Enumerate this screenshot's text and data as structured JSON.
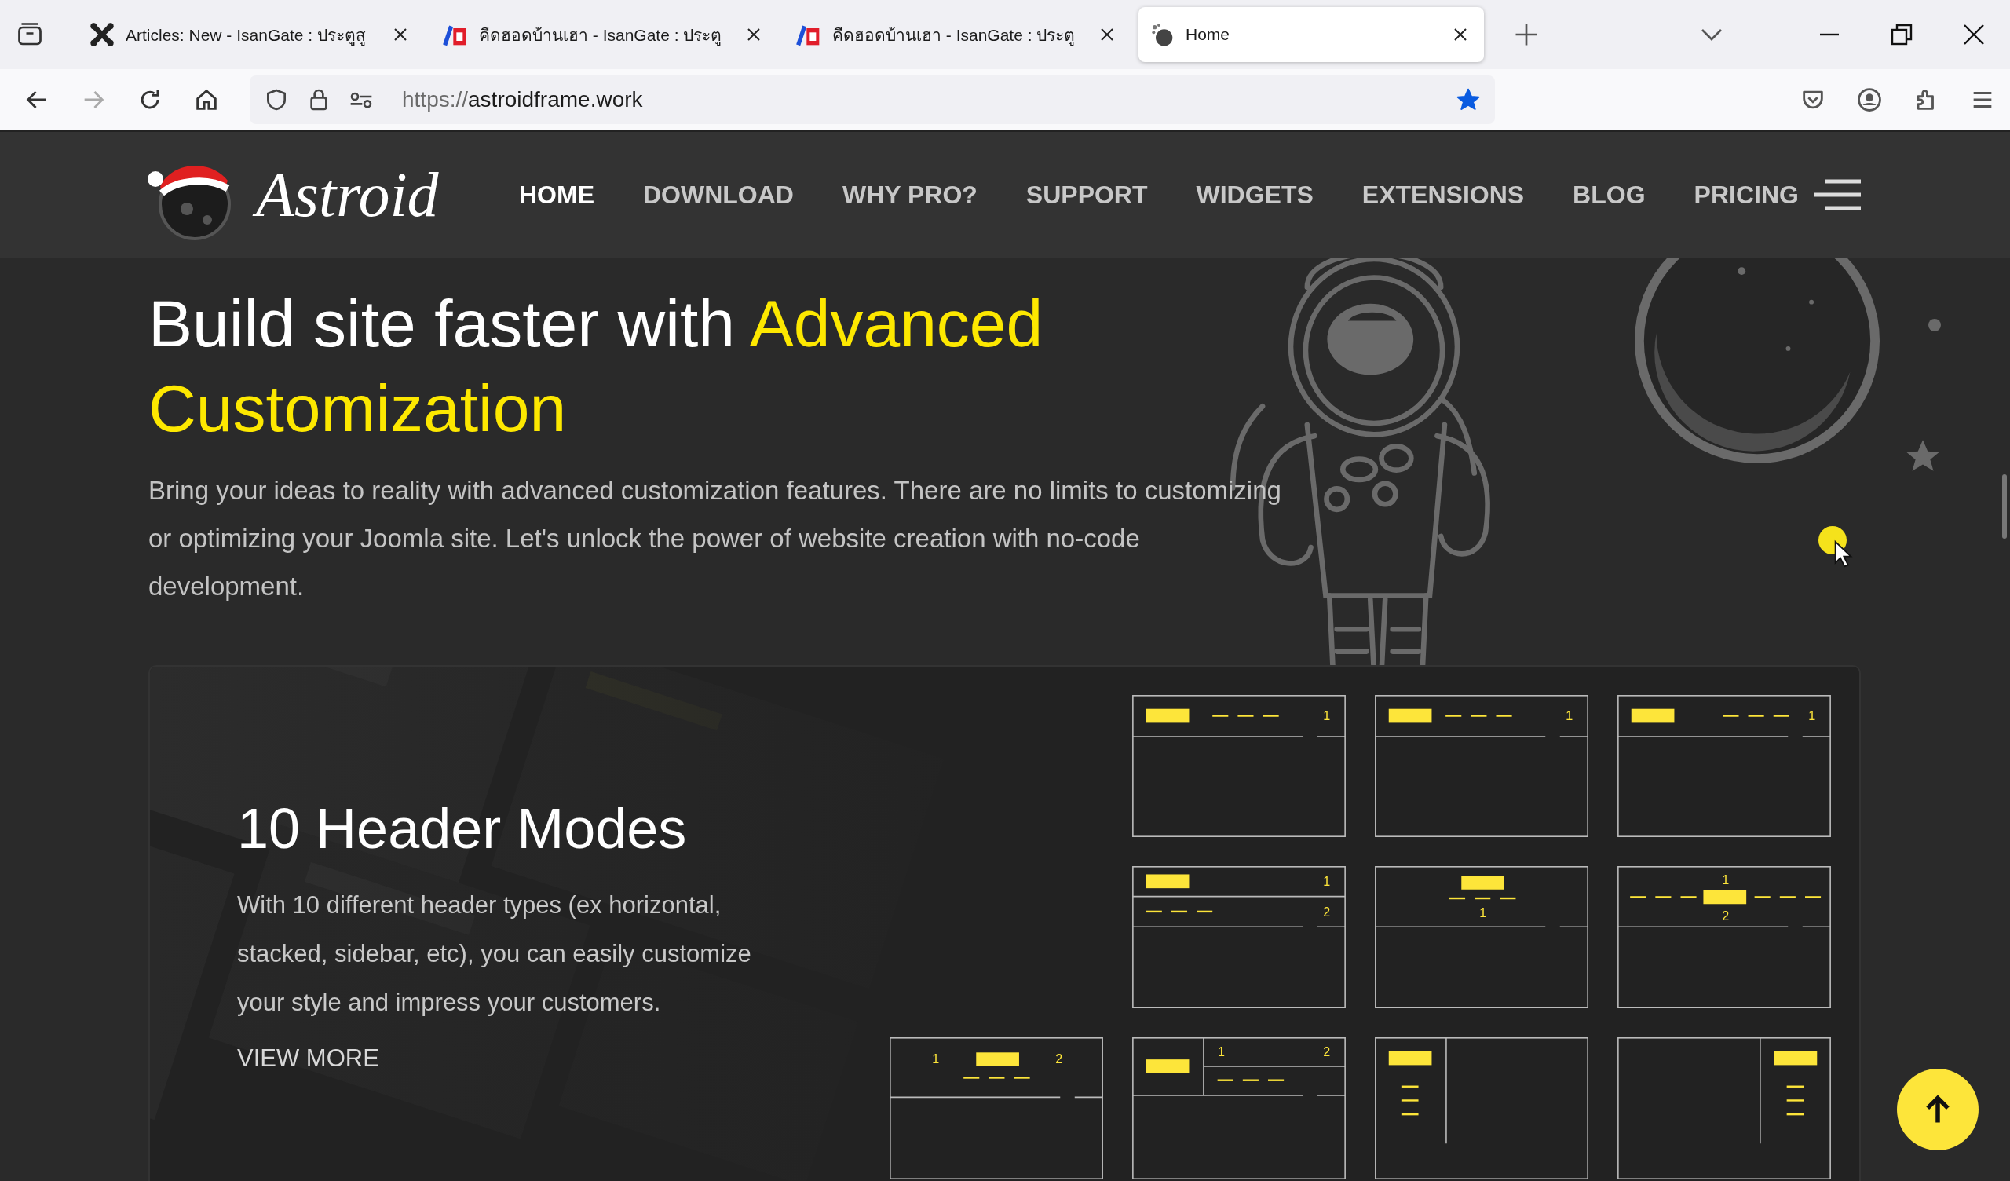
{
  "browser": {
    "tabs": [
      {
        "title": "Articles: New - IsanGate : ประตูสู",
        "kind": "cms",
        "selected": false
      },
      {
        "title": "คืดฮอดบ้านเฮา - IsanGate : ประตู",
        "kind": "portal",
        "selected": false
      },
      {
        "title": "คืดฮอดบ้านเฮา - IsanGate : ประตู",
        "kind": "portal",
        "selected": false
      },
      {
        "title": "Home",
        "kind": "site",
        "selected": true
      }
    ],
    "url": {
      "scheme": "https://",
      "host": "astroidframe.work"
    },
    "bookmarked": true
  },
  "site": {
    "logo": "Astroid",
    "nav": [
      {
        "label": "HOME",
        "selected": true
      },
      {
        "label": "DOWNLOAD",
        "selected": false
      },
      {
        "label": "WHY PRO?",
        "selected": false
      },
      {
        "label": "SUPPORT",
        "selected": false
      },
      {
        "label": "WIDGETS",
        "selected": false
      },
      {
        "label": "EXTENSIONS",
        "selected": false
      },
      {
        "label": "BLOG",
        "selected": false
      },
      {
        "label": "PRICING",
        "selected": false
      }
    ]
  },
  "hero": {
    "title": "Build site faster with ",
    "title_highlight": "Advanced Customization",
    "text": "Bring your ideas to reality with advanced customization features. There are no limits to customizing or optimizing your Joomla site. Let's unlock the power of website creation with no-code development."
  },
  "feature": {
    "title": "10 Header Modes",
    "text": "With 10 different header types (ex horizontal, stacked, sidebar, etc), you can easily customize your style and impress your customers.",
    "link": "VIEW MORE",
    "layouts": [
      {
        "kind": "menu-center",
        "labels": [
          "1"
        ]
      },
      {
        "kind": "menu-left",
        "labels": [
          "1"
        ]
      },
      {
        "kind": "menu-right",
        "labels": [
          "1"
        ]
      },
      {
        "kind": "stacked",
        "labels": [
          "1",
          "2"
        ]
      },
      {
        "kind": "centered",
        "labels": [
          "1"
        ]
      },
      {
        "kind": "divided",
        "labels": [
          "1",
          "2"
        ]
      },
      {
        "kind": "split-center",
        "labels": [
          "1",
          "2"
        ]
      },
      {
        "kind": "logo-column",
        "labels": [
          "1",
          "2"
        ]
      },
      {
        "kind": "sidebar-left"
      },
      {
        "kind": "sidebar-right"
      }
    ]
  }
}
